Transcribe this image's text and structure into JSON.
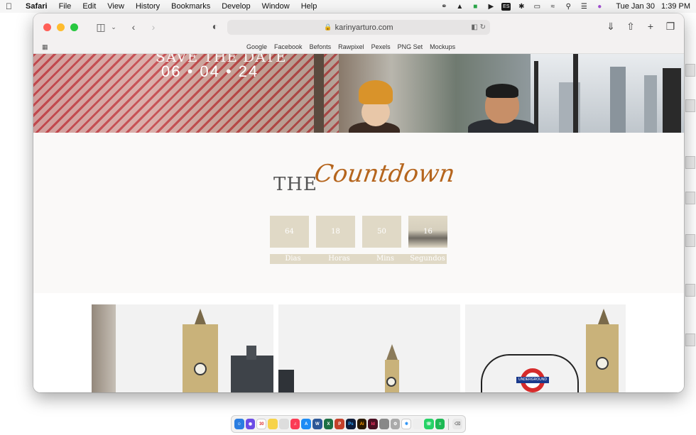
{
  "menubar": {
    "app_name": "Safari",
    "menus": [
      "File",
      "Edit",
      "View",
      "History",
      "Bookmarks",
      "Develop",
      "Window",
      "Help"
    ],
    "input_badge": "ES",
    "date": "Tue Jan 30",
    "time": "1:39 PM"
  },
  "browser": {
    "url": "karinyarturo.com",
    "bookmarks": [
      "Google",
      "Facebook",
      "Befonts",
      "Rawpixel",
      "Pexels",
      "PNG Set",
      "Mockups"
    ]
  },
  "hero": {
    "save_the_date": "SAVE THE DATE",
    "date": "06 • 04 • 24"
  },
  "countdown": {
    "title_prefix": "THE",
    "title_script": "Countdown",
    "values": {
      "days": "64",
      "hours": "18",
      "mins": "50",
      "secs": "16"
    },
    "labels": {
      "days": "Dias",
      "hours": "Horas",
      "mins": "Mins",
      "secs": "Segundos"
    }
  },
  "gallery": {
    "sign_text": "UNDERGROUND"
  },
  "dock": {
    "calendar_day": "30"
  },
  "colors": {
    "accent_script": "#b5651d",
    "countdown_box": "#e0d9c6"
  }
}
